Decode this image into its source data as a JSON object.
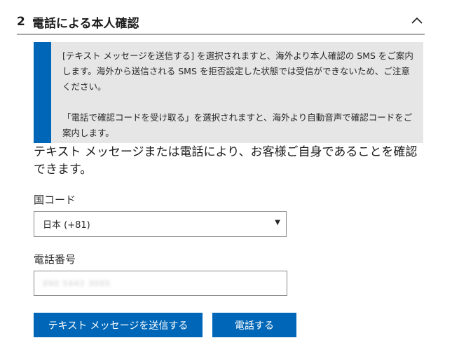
{
  "section": {
    "step_number": "2",
    "title": "電話による本人確認"
  },
  "notice": {
    "paragraph1": "[テキスト メッセージを送信する] を選択されますと、海外より本人確認の SMS をご案内します。海外から送信される SMS を拒否設定した状態では受信ができないため、ご注意ください。",
    "paragraph2": "「電話で確認コードを受け取る」を選択されますと、海外より自動音声で確認コードをご案内します。"
  },
  "intro": "テキスト メッセージまたは電話により、お客様ご自身であることを確認できます。",
  "country": {
    "label": "国コード",
    "selected": "日本 (+81)"
  },
  "phone": {
    "label": "電話番号",
    "value": "090 5442 3095"
  },
  "buttons": {
    "send_sms": "テキスト メッセージを送信する",
    "call": "電話する"
  },
  "colors": {
    "accent": "#0067b8",
    "notice_bg": "#e6e6e6"
  }
}
